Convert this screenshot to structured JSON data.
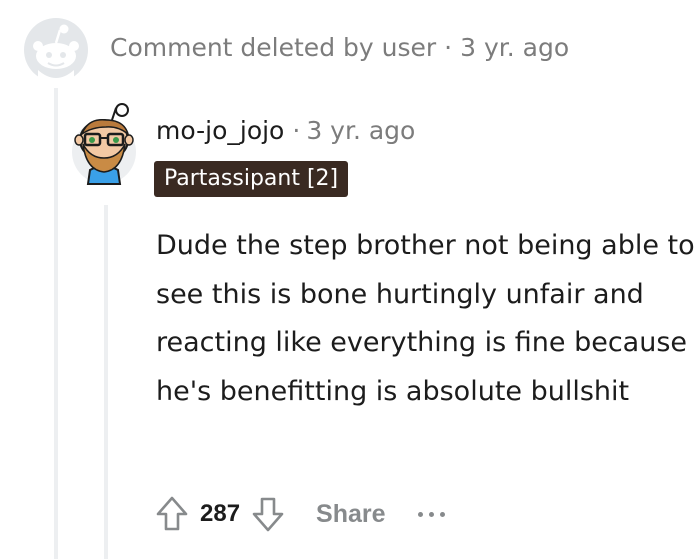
{
  "deleted_comment": {
    "status_text": "Comment deleted by user",
    "separator": "·",
    "timestamp": "3 yr. ago",
    "avatar_icon": "reddit-default-avatar-icon"
  },
  "reply": {
    "username": "mo-jo_jojo",
    "separator": "·",
    "timestamp": "3 yr. ago",
    "avatar_icon": "snoo-avatar-glasses-beard-icon",
    "flair": "Partassipant [2]",
    "flair_color": "#3a2a22",
    "body": "Dude the step brother not being able to see this is bone hurtingly unfair and reacting like everything is fine because he's benefitting is absolute bullshit",
    "actions": {
      "upvote_icon": "upvote-arrow-icon",
      "score": "287",
      "downvote_icon": "downvote-arrow-icon",
      "share_label": "Share",
      "more_icon": "more-options-icon"
    }
  }
}
